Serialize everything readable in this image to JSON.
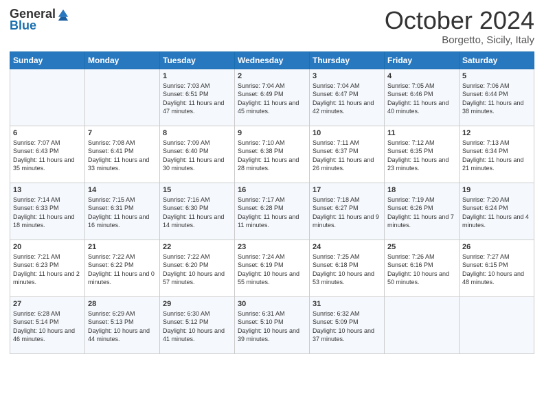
{
  "logo": {
    "general": "General",
    "blue": "Blue"
  },
  "title": "October 2024",
  "location": "Borgetto, Sicily, Italy",
  "days_of_week": [
    "Sunday",
    "Monday",
    "Tuesday",
    "Wednesday",
    "Thursday",
    "Friday",
    "Saturday"
  ],
  "weeks": [
    [
      {
        "day": "",
        "sunrise": "",
        "sunset": "",
        "daylight": ""
      },
      {
        "day": "",
        "sunrise": "",
        "sunset": "",
        "daylight": ""
      },
      {
        "day": "1",
        "sunrise": "Sunrise: 7:03 AM",
        "sunset": "Sunset: 6:51 PM",
        "daylight": "Daylight: 11 hours and 47 minutes."
      },
      {
        "day": "2",
        "sunrise": "Sunrise: 7:04 AM",
        "sunset": "Sunset: 6:49 PM",
        "daylight": "Daylight: 11 hours and 45 minutes."
      },
      {
        "day": "3",
        "sunrise": "Sunrise: 7:04 AM",
        "sunset": "Sunset: 6:47 PM",
        "daylight": "Daylight: 11 hours and 42 minutes."
      },
      {
        "day": "4",
        "sunrise": "Sunrise: 7:05 AM",
        "sunset": "Sunset: 6:46 PM",
        "daylight": "Daylight: 11 hours and 40 minutes."
      },
      {
        "day": "5",
        "sunrise": "Sunrise: 7:06 AM",
        "sunset": "Sunset: 6:44 PM",
        "daylight": "Daylight: 11 hours and 38 minutes."
      }
    ],
    [
      {
        "day": "6",
        "sunrise": "Sunrise: 7:07 AM",
        "sunset": "Sunset: 6:43 PM",
        "daylight": "Daylight: 11 hours and 35 minutes."
      },
      {
        "day": "7",
        "sunrise": "Sunrise: 7:08 AM",
        "sunset": "Sunset: 6:41 PM",
        "daylight": "Daylight: 11 hours and 33 minutes."
      },
      {
        "day": "8",
        "sunrise": "Sunrise: 7:09 AM",
        "sunset": "Sunset: 6:40 PM",
        "daylight": "Daylight: 11 hours and 30 minutes."
      },
      {
        "day": "9",
        "sunrise": "Sunrise: 7:10 AM",
        "sunset": "Sunset: 6:38 PM",
        "daylight": "Daylight: 11 hours and 28 minutes."
      },
      {
        "day": "10",
        "sunrise": "Sunrise: 7:11 AM",
        "sunset": "Sunset: 6:37 PM",
        "daylight": "Daylight: 11 hours and 26 minutes."
      },
      {
        "day": "11",
        "sunrise": "Sunrise: 7:12 AM",
        "sunset": "Sunset: 6:35 PM",
        "daylight": "Daylight: 11 hours and 23 minutes."
      },
      {
        "day": "12",
        "sunrise": "Sunrise: 7:13 AM",
        "sunset": "Sunset: 6:34 PM",
        "daylight": "Daylight: 11 hours and 21 minutes."
      }
    ],
    [
      {
        "day": "13",
        "sunrise": "Sunrise: 7:14 AM",
        "sunset": "Sunset: 6:33 PM",
        "daylight": "Daylight: 11 hours and 18 minutes."
      },
      {
        "day": "14",
        "sunrise": "Sunrise: 7:15 AM",
        "sunset": "Sunset: 6:31 PM",
        "daylight": "Daylight: 11 hours and 16 minutes."
      },
      {
        "day": "15",
        "sunrise": "Sunrise: 7:16 AM",
        "sunset": "Sunset: 6:30 PM",
        "daylight": "Daylight: 11 hours and 14 minutes."
      },
      {
        "day": "16",
        "sunrise": "Sunrise: 7:17 AM",
        "sunset": "Sunset: 6:28 PM",
        "daylight": "Daylight: 11 hours and 11 minutes."
      },
      {
        "day": "17",
        "sunrise": "Sunrise: 7:18 AM",
        "sunset": "Sunset: 6:27 PM",
        "daylight": "Daylight: 11 hours and 9 minutes."
      },
      {
        "day": "18",
        "sunrise": "Sunrise: 7:19 AM",
        "sunset": "Sunset: 6:26 PM",
        "daylight": "Daylight: 11 hours and 7 minutes."
      },
      {
        "day": "19",
        "sunrise": "Sunrise: 7:20 AM",
        "sunset": "Sunset: 6:24 PM",
        "daylight": "Daylight: 11 hours and 4 minutes."
      }
    ],
    [
      {
        "day": "20",
        "sunrise": "Sunrise: 7:21 AM",
        "sunset": "Sunset: 6:23 PM",
        "daylight": "Daylight: 11 hours and 2 minutes."
      },
      {
        "day": "21",
        "sunrise": "Sunrise: 7:22 AM",
        "sunset": "Sunset: 6:22 PM",
        "daylight": "Daylight: 11 hours and 0 minutes."
      },
      {
        "day": "22",
        "sunrise": "Sunrise: 7:22 AM",
        "sunset": "Sunset: 6:20 PM",
        "daylight": "Daylight: 10 hours and 57 minutes."
      },
      {
        "day": "23",
        "sunrise": "Sunrise: 7:24 AM",
        "sunset": "Sunset: 6:19 PM",
        "daylight": "Daylight: 10 hours and 55 minutes."
      },
      {
        "day": "24",
        "sunrise": "Sunrise: 7:25 AM",
        "sunset": "Sunset: 6:18 PM",
        "daylight": "Daylight: 10 hours and 53 minutes."
      },
      {
        "day": "25",
        "sunrise": "Sunrise: 7:26 AM",
        "sunset": "Sunset: 6:16 PM",
        "daylight": "Daylight: 10 hours and 50 minutes."
      },
      {
        "day": "26",
        "sunrise": "Sunrise: 7:27 AM",
        "sunset": "Sunset: 6:15 PM",
        "daylight": "Daylight: 10 hours and 48 minutes."
      }
    ],
    [
      {
        "day": "27",
        "sunrise": "Sunrise: 6:28 AM",
        "sunset": "Sunset: 5:14 PM",
        "daylight": "Daylight: 10 hours and 46 minutes."
      },
      {
        "day": "28",
        "sunrise": "Sunrise: 6:29 AM",
        "sunset": "Sunset: 5:13 PM",
        "daylight": "Daylight: 10 hours and 44 minutes."
      },
      {
        "day": "29",
        "sunrise": "Sunrise: 6:30 AM",
        "sunset": "Sunset: 5:12 PM",
        "daylight": "Daylight: 10 hours and 41 minutes."
      },
      {
        "day": "30",
        "sunrise": "Sunrise: 6:31 AM",
        "sunset": "Sunset: 5:10 PM",
        "daylight": "Daylight: 10 hours and 39 minutes."
      },
      {
        "day": "31",
        "sunrise": "Sunrise: 6:32 AM",
        "sunset": "Sunset: 5:09 PM",
        "daylight": "Daylight: 10 hours and 37 minutes."
      },
      {
        "day": "",
        "sunrise": "",
        "sunset": "",
        "daylight": ""
      },
      {
        "day": "",
        "sunrise": "",
        "sunset": "",
        "daylight": ""
      }
    ]
  ]
}
